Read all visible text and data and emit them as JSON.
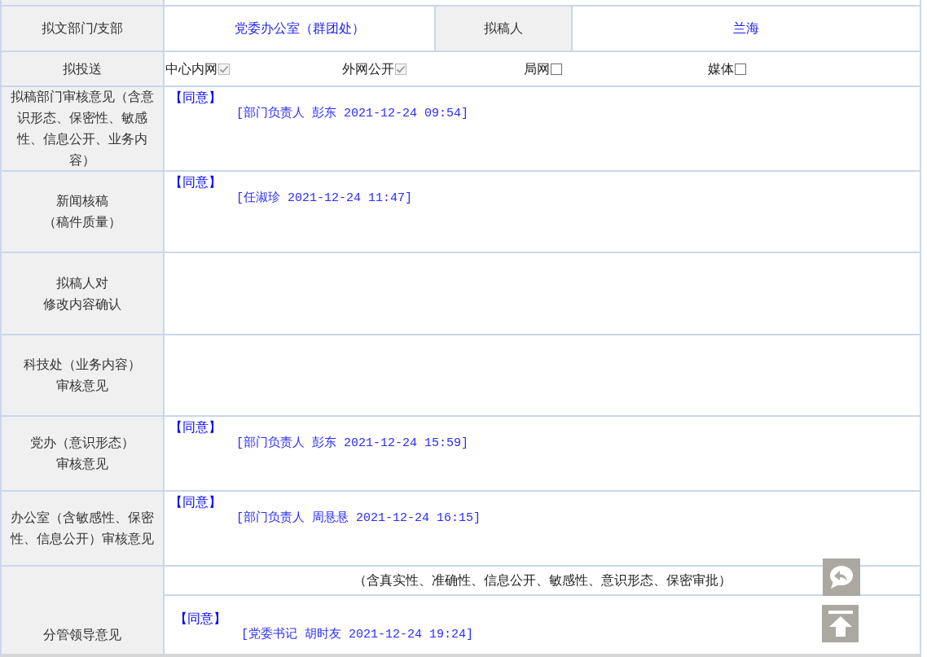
{
  "form": {
    "draft_info": {
      "department_label": "拟文部门/支部",
      "department": "党委办公室（群团处）",
      "drafter_label": "拟稿人",
      "drafter": "兰海"
    },
    "distribution": {
      "label": "拟投送",
      "options": [
        {
          "label": "中心内网",
          "checked": true
        },
        {
          "label": "外网公开",
          "checked": true
        },
        {
          "label": "局网",
          "checked": false
        },
        {
          "label": "媒体",
          "checked": false
        }
      ]
    },
    "reviews": [
      {
        "label": [
          "拟稿部门审核意见（含意识形态、保密性、敏感性、信息公开、业务内容）"
        ],
        "opinion": "【同意】",
        "signature": "[部门负责人 彭东 2021-12-24 09:54]"
      },
      {
        "label": [
          "新闻核稿",
          "（稿件质量）"
        ],
        "opinion": "【同意】",
        "signature": "[任淑珍 2021-12-24 11:47]"
      },
      {
        "label": [
          "拟稿人对",
          "修改内容确认"
        ]
      },
      {
        "label": [
          "科技处（业务内容）",
          "审核意见"
        ]
      },
      {
        "label": [
          "党办（意识形态）",
          "审核意见"
        ],
        "opinion": "【同意】",
        "signature": "[部门负责人 彭东 2021-12-24 15:59]"
      },
      {
        "label": [
          "办公室（含敏感性、保密性、信息公开）审核意见"
        ],
        "opinion": "【同意】",
        "signature": "[部门负责人 周悬悬 2021-12-24 16:15]"
      }
    ],
    "leader_review": {
      "label": "分管领导意见",
      "note": "（含真实性、准确性、信息公开、敏感性、意识形态、保密审批）",
      "opinion": "【同意】",
      "signature": "[党委书记 胡时友 2021-12-24 19:24]"
    }
  },
  "floating_buttons": [
    {
      "kind": "reply"
    },
    {
      "kind": "back_to_top"
    }
  ]
}
